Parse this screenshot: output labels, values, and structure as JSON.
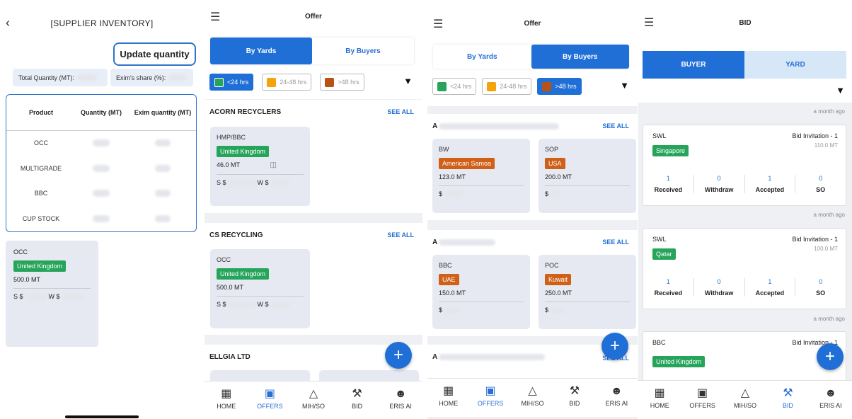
{
  "inventory": {
    "title": "[SUPPLIER INVENTORY]",
    "update_button": "Update quantity",
    "total_label": "Total Quantity (MT):",
    "share_label": "Exim's share (%):",
    "table": {
      "headers": [
        "Product",
        "Quantity (MT)",
        "Exim quantity (MT)"
      ],
      "rows": [
        "OCC",
        "MULTIGRADE",
        "BBC",
        "CUP STOCK"
      ]
    },
    "card": {
      "material": "OCC",
      "country": "United Kingdom",
      "quantity": "500.0 MT",
      "s_label": "S $",
      "w_label": "W $"
    }
  },
  "offers_yards": {
    "title": "Offer",
    "tabs": [
      "By Yards",
      "By Buyers"
    ],
    "filters": [
      "<24 hrs",
      "24-48 hrs",
      ">48 hrs"
    ],
    "sections": [
      {
        "name": "ACORN RECYCLERS",
        "see_all": "SEE ALL",
        "card": {
          "material": "HMP/BBC",
          "country": "United Kingdom",
          "quantity": "46.0 MT",
          "s_label": "S $",
          "w_label": "W $"
        }
      },
      {
        "name": "CS RECYCLING",
        "see_all": "SEE ALL",
        "card": {
          "material": "OCC",
          "country": "United Kingdom",
          "quantity": "500.0 MT",
          "s_label": "S $",
          "w_label": "W $"
        }
      },
      {
        "name": "ELLGIA LTD"
      }
    ]
  },
  "offers_buyers": {
    "title": "Offer",
    "tabs": [
      "By Yards",
      "By Buyers"
    ],
    "filters": [
      "<24 hrs",
      "24-48 hrs",
      ">48 hrs"
    ],
    "sections": [
      {
        "prefix": "A",
        "see_all": "SEE ALL",
        "cards": [
          {
            "material": "BW",
            "country": "American Samoa",
            "quantity": "123.0 MT",
            "price": "$"
          },
          {
            "material": "SOP",
            "country": "USA",
            "quantity": "200.0 MT",
            "price": "$"
          }
        ]
      },
      {
        "prefix": "A",
        "see_all": "SEE ALL",
        "cards": [
          {
            "material": "BBC",
            "country": "UAE",
            "quantity": "150.0 MT",
            "price": "$"
          },
          {
            "material": "POC",
            "country": "Kuwait",
            "quantity": "250.0 MT",
            "price": "$"
          }
        ]
      },
      {
        "prefix": "A",
        "see_all": "SEE ALL"
      }
    ]
  },
  "bid": {
    "title": "BID",
    "segments": [
      "BUYER",
      "YARD"
    ],
    "time_ago": "a month ago",
    "cards": [
      {
        "supplier": "SWL",
        "invite": "Bid Invitation - 1",
        "qty": "110.0 MT",
        "country": "Singapore",
        "stats": [
          {
            "n": "1",
            "l": "Received"
          },
          {
            "n": "0",
            "l": "Withdraw"
          },
          {
            "n": "1",
            "l": "Accepted"
          },
          {
            "n": "0",
            "l": "SO"
          }
        ]
      },
      {
        "supplier": "SWL",
        "invite": "Bid Invitation - 1",
        "qty": "100.0 MT",
        "country": "Qatar",
        "stats": [
          {
            "n": "1",
            "l": "Received"
          },
          {
            "n": "0",
            "l": "Withdraw"
          },
          {
            "n": "1",
            "l": "Accepted"
          },
          {
            "n": "0",
            "l": "SO"
          }
        ]
      },
      {
        "supplier": "BBC",
        "invite": "Bid Invitation - 1",
        "country": "United Kingdom"
      }
    ]
  },
  "nav": {
    "items": [
      {
        "label": "HOME",
        "icon": "home-grid-icon"
      },
      {
        "label": "OFFERS",
        "icon": "briefcase-icon"
      },
      {
        "label": "MIH/SO",
        "icon": "ship-icon"
      },
      {
        "label": "BID",
        "icon": "gavel-icon"
      },
      {
        "label": "ERIS AI",
        "icon": "robot-icon"
      }
    ]
  },
  "colors": {
    "accent": "#1f6fd7",
    "green": "#26a55a",
    "orange": "#d05f17",
    "filter_lt24": "#26a55a",
    "filter_24_48": "#f5a30b",
    "filter_gt48": "#b85315"
  }
}
